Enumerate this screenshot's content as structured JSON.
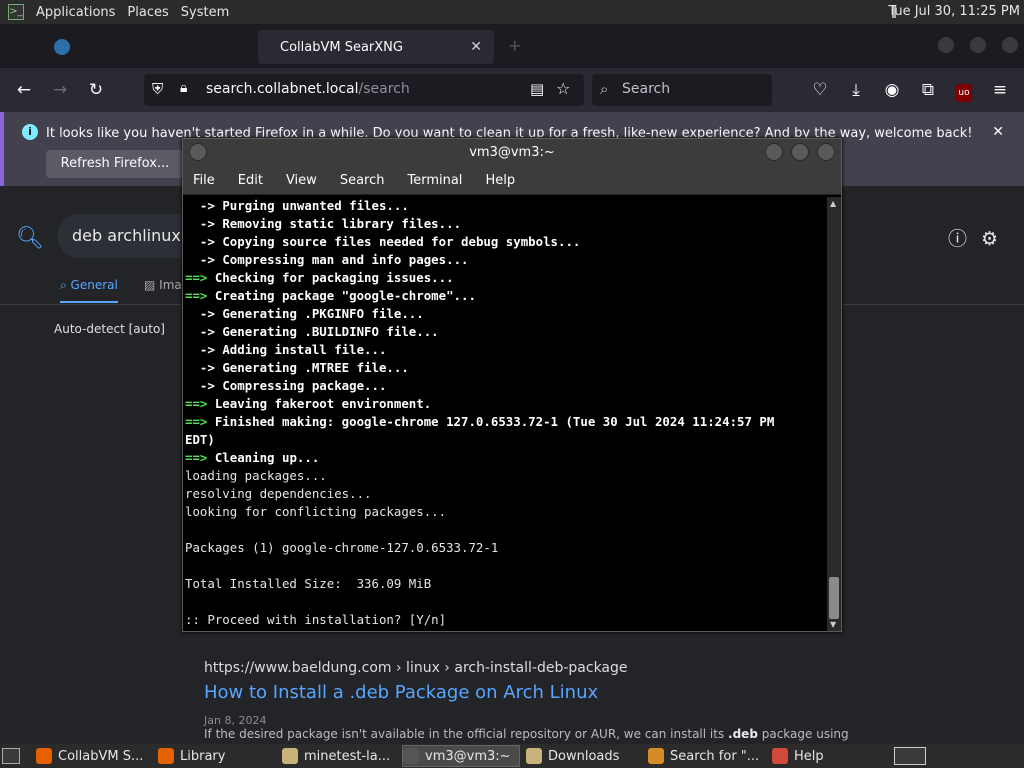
{
  "top_panel": {
    "menus": [
      "Applications",
      "Places",
      "System"
    ],
    "clock": "Tue Jul 30, 11:25 PM"
  },
  "firefox": {
    "tabs": [
      {
        "label": "",
        "active": false
      },
      {
        "label": "CollabVM SearXNG",
        "active": true
      }
    ],
    "url": {
      "domain": "search.collabnet.local",
      "path": "/search"
    },
    "search_placeholder": "Search",
    "notification": {
      "message": "It looks like you haven't started Firefox in a while. Do you want to clean it up for a fresh, like-new experience? And by the way, welcome back!",
      "button": "Refresh Firefox..."
    }
  },
  "page": {
    "query": "deb archlinux",
    "tabs": [
      "General",
      "Ima"
    ],
    "autodetect": "Auto-detect [auto]",
    "result": {
      "url": "https://www.baeldung.com",
      "crumbs": "› linux › arch-install-deb-package",
      "title": "How to Install a .deb Package on Arch Linux",
      "date": "Jan 8, 2024",
      "snippet_pre": "If the desired package isn't available in the official repository or AUR, we can install its ",
      "snippet_bold": ".deb",
      "snippet_post": " package using"
    }
  },
  "terminal": {
    "title": "vm3@vm3:~",
    "menus": [
      "File",
      "Edit",
      "View",
      "Search",
      "Terminal",
      "Help"
    ],
    "lines": [
      {
        "prefix": "  -> ",
        "style": "arrow",
        "text": "Purging unwanted files..."
      },
      {
        "prefix": "  -> ",
        "style": "arrow",
        "text": "Removing static library files..."
      },
      {
        "prefix": "  -> ",
        "style": "arrow",
        "text": "Copying source files needed for debug symbols..."
      },
      {
        "prefix": "  -> ",
        "style": "arrow",
        "text": "Compressing man and info pages..."
      },
      {
        "prefix": "==> ",
        "style": "green",
        "text": "Checking for packaging issues..."
      },
      {
        "prefix": "==> ",
        "style": "green",
        "text": "Creating package \"google-chrome\"..."
      },
      {
        "prefix": "  -> ",
        "style": "arrow",
        "text": "Generating .PKGINFO file..."
      },
      {
        "prefix": "  -> ",
        "style": "arrow",
        "text": "Generating .BUILDINFO file..."
      },
      {
        "prefix": "  -> ",
        "style": "arrow",
        "text": "Adding install file..."
      },
      {
        "prefix": "  -> ",
        "style": "arrow",
        "text": "Generating .MTREE file..."
      },
      {
        "prefix": "  -> ",
        "style": "arrow",
        "text": "Compressing package..."
      },
      {
        "prefix": "==> ",
        "style": "green",
        "text": "Leaving fakeroot environment."
      },
      {
        "prefix": "==> ",
        "style": "green",
        "text": "Finished making: google-chrome 127.0.6533.72-1 (Tue 30 Jul 2024 11:24:57 PM"
      },
      {
        "prefix": "",
        "style": "bold",
        "text": "EDT)"
      },
      {
        "prefix": "==> ",
        "style": "green",
        "text": "Cleaning up..."
      },
      {
        "prefix": "",
        "style": "plain",
        "text": "loading packages..."
      },
      {
        "prefix": "",
        "style": "plain",
        "text": "resolving dependencies..."
      },
      {
        "prefix": "",
        "style": "plain",
        "text": "looking for conflicting packages..."
      },
      {
        "prefix": "",
        "style": "plain",
        "text": ""
      },
      {
        "prefix": "",
        "style": "plain",
        "text": "Packages (1) google-chrome-127.0.6533.72-1"
      },
      {
        "prefix": "",
        "style": "plain",
        "text": ""
      },
      {
        "prefix": "",
        "style": "plain",
        "text": "Total Installed Size:  336.09 MiB"
      },
      {
        "prefix": "",
        "style": "plain",
        "text": ""
      },
      {
        "prefix": "",
        "style": "plain",
        "text": ":: Proceed with installation? [Y/n]"
      }
    ]
  },
  "taskbar": {
    "tasks": [
      {
        "label": "CollabVM S...",
        "icon": "firefox-icon",
        "color": "#e66000"
      },
      {
        "label": "Library",
        "icon": "firefox-icon",
        "color": "#e66000"
      },
      {
        "label": "minetest-la...",
        "icon": "folder-icon",
        "color": "#c8b27a"
      },
      {
        "label": "vm3@vm3:~",
        "icon": "terminal-icon",
        "color": "#555555",
        "active": true
      },
      {
        "label": "Downloads",
        "icon": "folder-icon",
        "color": "#c8b27a"
      },
      {
        "label": "Search for \"...",
        "icon": "search-folder-icon",
        "color": "#d88a2a"
      },
      {
        "label": "Help",
        "icon": "help-lifebuoy-icon",
        "color": "#d24a3a"
      }
    ]
  },
  "colors": {
    "accent": "#58a6ff",
    "terminal_green": "#4ee44e",
    "notification_bar": "#42414d"
  }
}
